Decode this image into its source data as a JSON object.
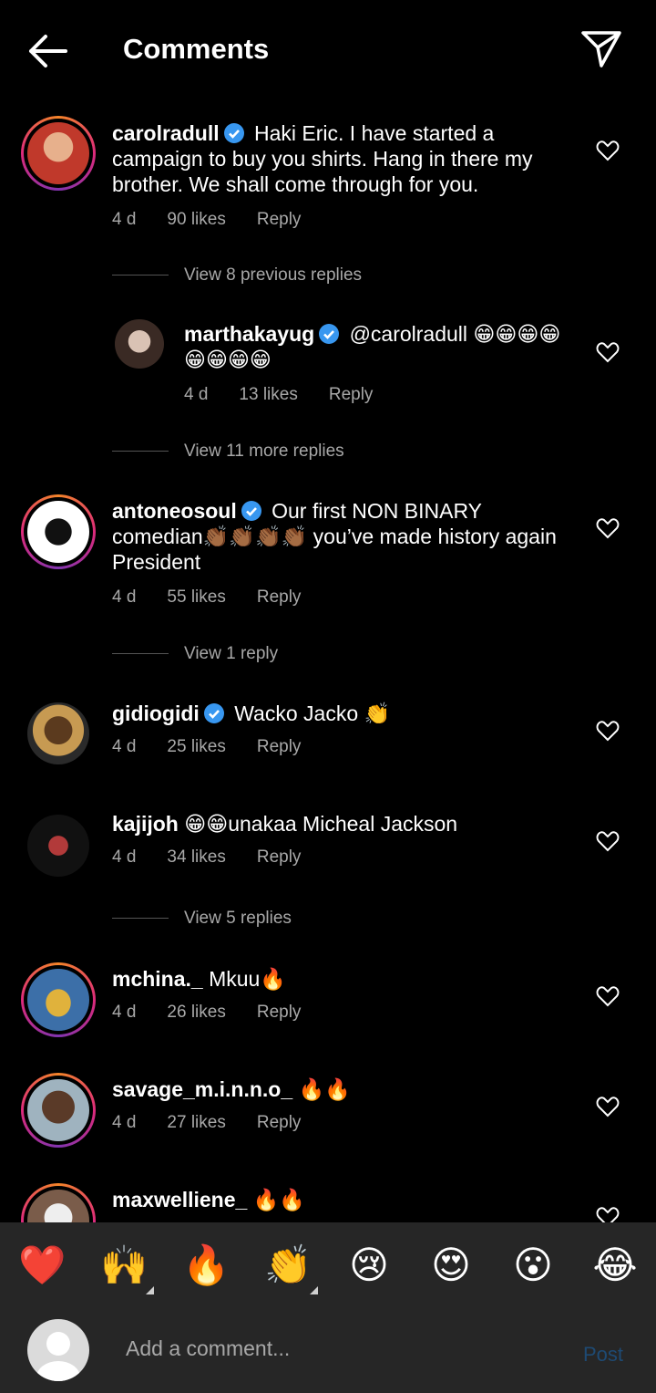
{
  "header": {
    "title": "Comments",
    "back_icon": "arrow-left-icon",
    "share_icon": "paper-plane-icon"
  },
  "comments": [
    {
      "user": "carolradull",
      "verified": true,
      "text": "Haki Eric. I have started a campaign to buy you shirts. Hang in there my brother. We shall come through for you.",
      "time": "4 d",
      "likes": "90 likes",
      "reply": "Reply",
      "view_replies": "View 8 previous replies"
    },
    {
      "user": "marthakayug",
      "verified": true,
      "text": "@carolradull 😁😁😁😁😁😁😁😁",
      "time": "4 d",
      "likes": "13 likes",
      "reply": "Reply",
      "view_replies": "View 11 more replies"
    },
    {
      "user": "antoneosoul",
      "verified": true,
      "text": "Our first NON BINARY comedian👏🏾👏🏾👏🏾👏🏾 you’ve made history again President",
      "time": "4 d",
      "likes": "55 likes",
      "reply": "Reply",
      "view_replies": "View 1 reply"
    },
    {
      "user": "gidiogidi",
      "verified": true,
      "text": "Wacko Jacko 👏",
      "time": "4 d",
      "likes": "25 likes",
      "reply": "Reply"
    },
    {
      "user": "kajijoh",
      "verified": false,
      "text": "😁😁unakaa Micheal Jackson",
      "time": "4 d",
      "likes": "34 likes",
      "reply": "Reply",
      "view_replies": "View 5 replies"
    },
    {
      "user": "mchina._",
      "verified": false,
      "text": "Mkuu🔥",
      "time": "4 d",
      "likes": "26 likes",
      "reply": "Reply"
    },
    {
      "user": "savage_m.i.n.n.o_",
      "verified": false,
      "text": "🔥🔥",
      "time": "4 d",
      "likes": "27 likes",
      "reply": "Reply"
    },
    {
      "user": "maxwelliene_",
      "verified": false,
      "text": "🔥🔥"
    }
  ],
  "emoji_bar": [
    "❤️",
    "🙌",
    "🔥",
    "👏",
    "😢",
    "😍",
    "😮",
    "😂"
  ],
  "input": {
    "placeholder": "Add a comment...",
    "post_label": "Post"
  },
  "colors": {
    "accent": "#0095f6",
    "post_disabled": "#1e4a73",
    "muted": "#a8a8a8",
    "bar": "#262626"
  }
}
